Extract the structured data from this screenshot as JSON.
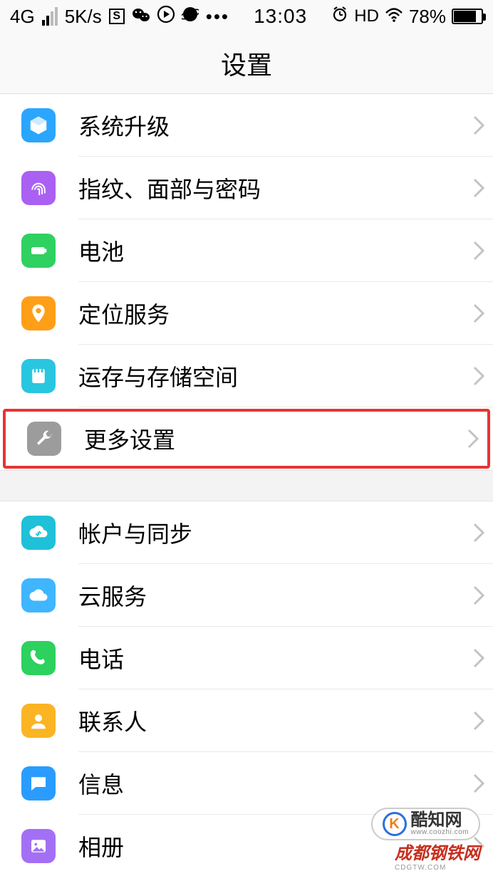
{
  "status": {
    "network": "4G",
    "speed": "5K/s",
    "time": "13:03",
    "hd": "HD",
    "battery_pct": "78%"
  },
  "header": {
    "title": "设置"
  },
  "group1": [
    {
      "label": "系统升级"
    },
    {
      "label": "指纹、面部与密码"
    },
    {
      "label": "电池"
    },
    {
      "label": "定位服务"
    },
    {
      "label": "运存与存储空间"
    },
    {
      "label": "更多设置"
    }
  ],
  "group2": [
    {
      "label": "帐户与同步"
    },
    {
      "label": "云服务"
    },
    {
      "label": "电话"
    },
    {
      "label": "联系人"
    },
    {
      "label": "信息"
    },
    {
      "label": "相册"
    }
  ],
  "watermark1": {
    "logo_text": "K",
    "zh": "酷知网",
    "en": "www.coozhi.com"
  },
  "watermark2": {
    "zh": "成都钢铁网",
    "en": "CDGTW.COM"
  }
}
